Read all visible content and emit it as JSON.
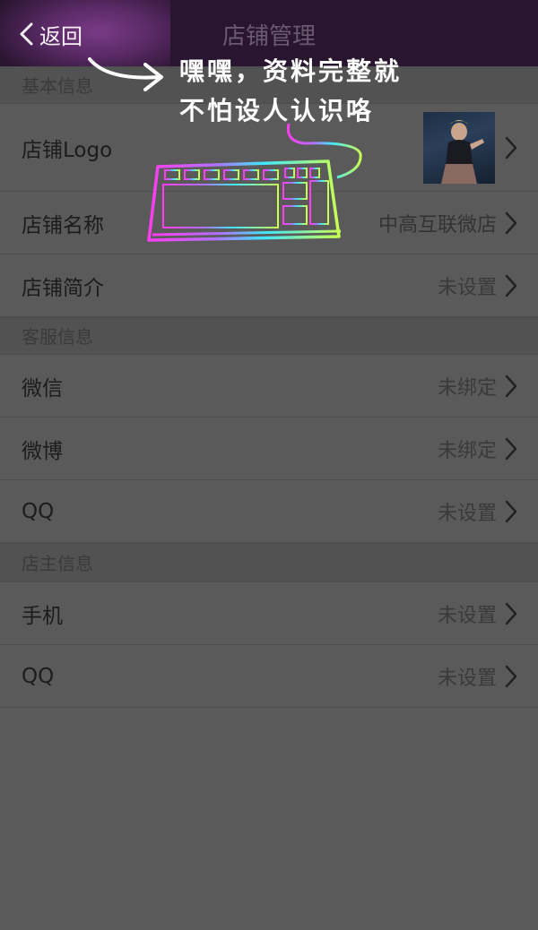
{
  "navbar": {
    "back_label": "返回",
    "title": "店铺管理"
  },
  "sections": {
    "basic": "基本信息",
    "service": "客服信息",
    "owner": "店主信息"
  },
  "rows": {
    "logo": {
      "label": "店铺Logo"
    },
    "name": {
      "label": "店铺名称",
      "value": "中高互联微店"
    },
    "intro": {
      "label": "店铺简介",
      "value": "未设置"
    },
    "wechat": {
      "label": "微信",
      "value": "未绑定"
    },
    "weibo": {
      "label": "微博",
      "value": "未绑定"
    },
    "qq_service": {
      "label": "QQ",
      "value": "未设置"
    },
    "phone": {
      "label": "手机",
      "value": "未设置"
    },
    "qq_owner": {
      "label": "QQ",
      "value": "未设置"
    }
  },
  "overlay": {
    "caption_line1": "嘿嘿，资料完整就",
    "caption_line2": "不怕设人认识咯",
    "sticker_icon": "keyboard-icon",
    "arrow_icon": "curved-arrow-icon"
  },
  "colors": {
    "navbar": "#2a1530",
    "background": "#5a5a5a"
  }
}
